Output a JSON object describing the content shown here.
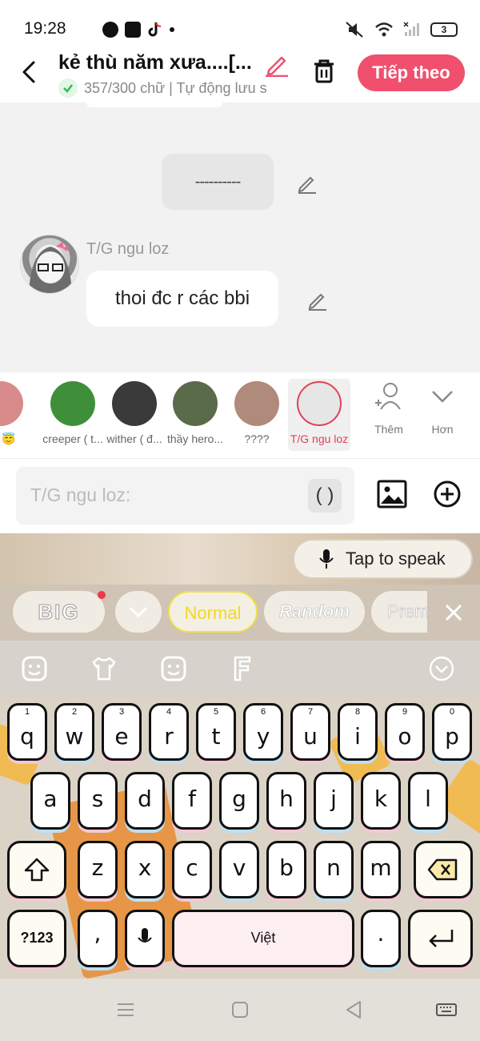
{
  "status_bar": {
    "time": "19:28",
    "battery": "3",
    "app_icons": [
      "globe-icon",
      "shop-icon",
      "tiktok-icon",
      "dot-icon"
    ],
    "system_icons": [
      "mute-icon",
      "wifi-icon",
      "signal-icon",
      "battery-icon"
    ]
  },
  "header": {
    "title": "kẻ thù năm xưa....[...",
    "subtitle": "357/300 chữ | Tự động lưu s",
    "next_label": "Tiếp theo",
    "accent_color": "#f0506e"
  },
  "chat": {
    "separator_text": "----------",
    "author": "T/G ngu loz",
    "message": "thoi đc r các bbi"
  },
  "characters": [
    {
      "name": "an 😇",
      "color": "#d98a8a"
    },
    {
      "name": "creeper ( t...",
      "color": "#3f8f3a"
    },
    {
      "name": "wither ( đ...",
      "color": "#3a3a3a"
    },
    {
      "name": "thầy hero...",
      "color": "#5a6b4a"
    },
    {
      "name": "????",
      "color": "#b08a7a"
    },
    {
      "name": "T/G ngu loz",
      "color": "#e6e6e6",
      "selected": true
    }
  ],
  "char_actions": {
    "add_label": "Thêm",
    "more_label": "Hơn"
  },
  "input": {
    "placeholder": "T/G ngu loz:",
    "paren_label": "( )"
  },
  "keyboard": {
    "speak_label": "Tap to speak",
    "font_chips": [
      "BIG",
      "Normal",
      "Random",
      "Prem"
    ],
    "rows": [
      [
        {
          "k": "q",
          "n": "1"
        },
        {
          "k": "w",
          "n": "2"
        },
        {
          "k": "e",
          "n": "3"
        },
        {
          "k": "r",
          "n": "4"
        },
        {
          "k": "t",
          "n": "5"
        },
        {
          "k": "y",
          "n": "6"
        },
        {
          "k": "u",
          "n": "7"
        },
        {
          "k": "i",
          "n": "8"
        },
        {
          "k": "o",
          "n": "9"
        },
        {
          "k": "p",
          "n": "0"
        }
      ],
      [
        {
          "k": "a"
        },
        {
          "k": "s"
        },
        {
          "k": "d"
        },
        {
          "k": "f"
        },
        {
          "k": "g"
        },
        {
          "k": "h"
        },
        {
          "k": "j"
        },
        {
          "k": "k"
        },
        {
          "k": "l"
        }
      ],
      [
        {
          "k": "z"
        },
        {
          "k": "x"
        },
        {
          "k": "c"
        },
        {
          "k": "v"
        },
        {
          "k": "b"
        },
        {
          "k": "n"
        },
        {
          "k": "m"
        }
      ]
    ],
    "symbols_label": "?123",
    "space_label": "Việt",
    "comma_label": ",",
    "period_label": "."
  }
}
